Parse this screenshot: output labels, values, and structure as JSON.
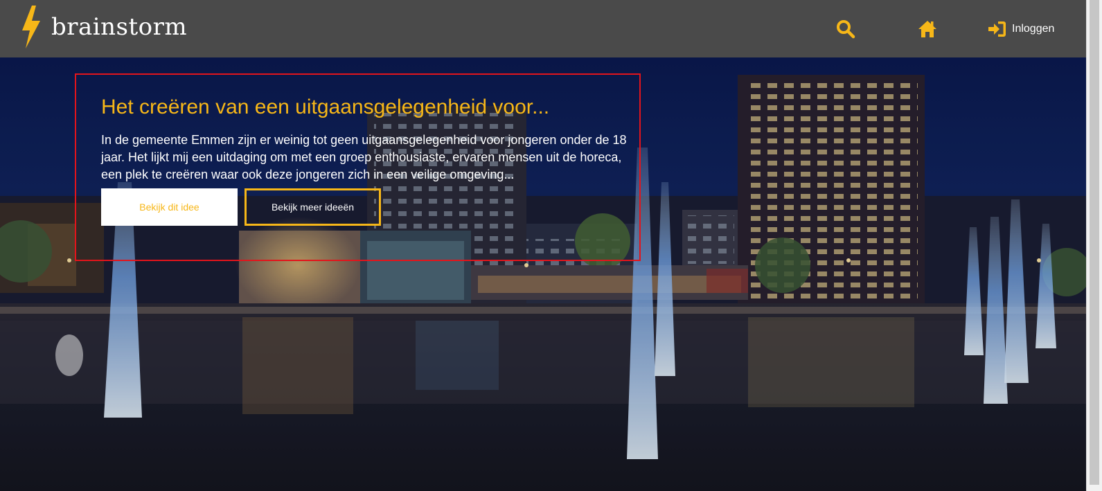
{
  "header": {
    "logo_text": "brainstorm",
    "search_icon": "search-icon",
    "home_icon": "home-icon",
    "login": {
      "icon": "sign-in-icon",
      "label": "Inloggen"
    }
  },
  "feature": {
    "title": "Het creëren van een uitgaansgelegenheid voor...",
    "description": "In de gemeente Emmen zijn er weinig tot geen uitgaansgelegenheid voor jongeren onder de 18 jaar. Het lijkt mij een uitdaging om met een groep enthousiaste, ervaren mensen uit de horeca, een plek te creëren waar ook deze jongeren zich in een veilige omgeving...",
    "primary_button": "Bekijk dit idee",
    "secondary_button": "Bekijk meer ideeën"
  },
  "colors": {
    "header_bg": "#4a4a4a",
    "accent": "#f7b718",
    "highlight_border": "#e3141b"
  }
}
